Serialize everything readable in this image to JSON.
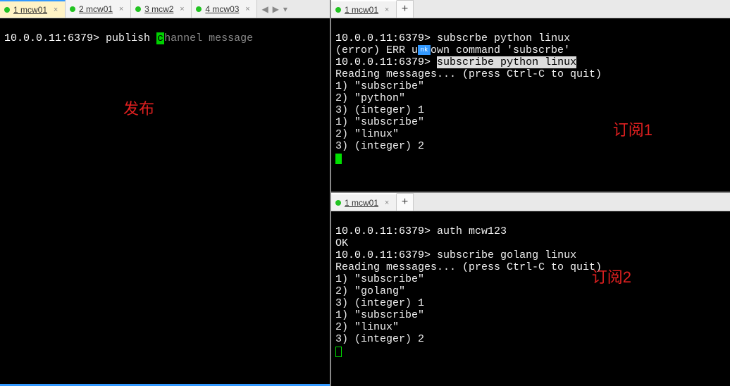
{
  "left_tabs": {
    "items": [
      {
        "label": "1 mcw01",
        "active": true
      },
      {
        "label": "2 mcw01",
        "active": false
      },
      {
        "label": "3 mcw2",
        "active": false
      },
      {
        "label": "4 mcw03",
        "active": false
      }
    ],
    "nav_left": "◀",
    "nav_right": "▶",
    "nav_down": "▾"
  },
  "left_term": {
    "prompt": "10.0.0.11:6379>",
    "cmd_pre": "publish ",
    "cursor_char": "c",
    "cmd_post": "hannel message"
  },
  "annotations": {
    "publish": "发布",
    "sub1": "订阅1",
    "sub2": "订阅2"
  },
  "right_top": {
    "tab_label": "1 mcw01",
    "new_tab": "+",
    "lines": {
      "l1_prompt": "10.0.0.11:6379>",
      "l1_cmd": "subscrbe python linux",
      "l2a": "(error) ERR u",
      "l2b": "nk",
      "l2c": "own command 'subscrbe'",
      "l3_prompt": "10.0.0.11:6379>",
      "l3_cmd": "subscribe python linux",
      "l4": "Reading messages... (press Ctrl-C to quit)",
      "l5": "1) \"subscribe\"",
      "l6": "2) \"python\"",
      "l7": "3) (integer) 1",
      "l8": "1) \"subscribe\"",
      "l9": "2) \"linux\"",
      "l10": "3) (integer) 2"
    }
  },
  "right_bot": {
    "tab_label": "1 mcw01",
    "new_tab": "+",
    "lines": {
      "l1_prompt": "10.0.0.11:6379>",
      "l1_cmd": "auth mcw123",
      "l2": "OK",
      "l3_prompt": "10.0.0.11:6379>",
      "l3_cmd": "subscribe golang linux",
      "l4": "Reading messages... (press Ctrl-C to quit)",
      "l5": "1) \"subscribe\"",
      "l6": "2) \"golang\"",
      "l7": "3) (integer) 1",
      "l8": "1) \"subscribe\"",
      "l9": "2) \"linux\"",
      "l10": "3) (integer) 2"
    }
  }
}
